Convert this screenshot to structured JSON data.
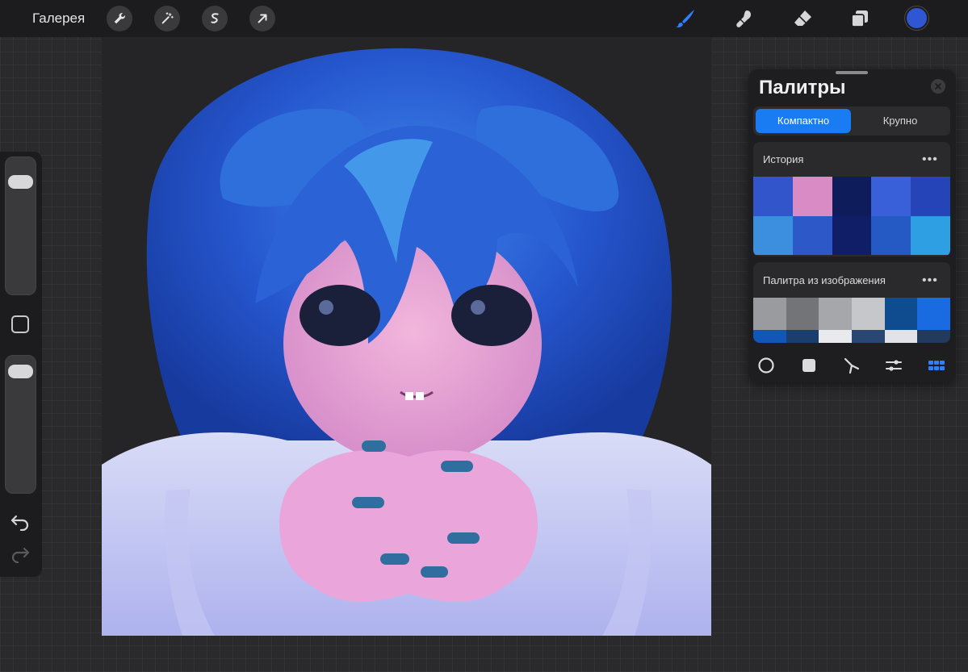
{
  "toolbar": {
    "gallery_label": "Галерея",
    "left_tools": [
      "wrench-icon",
      "magic-wand-icon",
      "selection-icon",
      "transform-arrow-icon"
    ],
    "right_tools": [
      "brush-icon",
      "smudge-icon",
      "eraser-icon",
      "layers-icon"
    ],
    "current_color": "#2f57d4",
    "accent_color": "#2f80ff"
  },
  "sidebar": {
    "brush_size_level": 0.12,
    "opacity_level": 0.05,
    "icons": [
      "modify-square-icon",
      "undo-icon",
      "redo-icon"
    ]
  },
  "palettes_panel": {
    "title": "Палитры",
    "view_modes": [
      {
        "label": "Компактно",
        "active": true
      },
      {
        "label": "Крупно",
        "active": false
      }
    ],
    "palettes": [
      {
        "name": "История",
        "more": "•••",
        "swatches": [
          "#3355cc",
          "#d88bc4",
          "#0f1c5c",
          "#3960d8",
          "#2444b8",
          "#3c8fde",
          "#2d59c8",
          "#0f1e66",
          "#255ac4",
          "#2e9fe2"
        ]
      },
      {
        "name": "Палитра из изображения",
        "more": "•••",
        "swatches": [
          "#9a9b9e",
          "#737477",
          "#a6a7aa",
          "#c6c7ca",
          "#0f4b8f",
          "#1a6ae2",
          "#1257b8",
          "#1a3e6e",
          "#e8eaee",
          "#2a4672",
          "#e1e3e8",
          "#213a5e"
        ]
      }
    ],
    "bottom_tools": [
      "disc-icon",
      "classic-square-icon",
      "harmony-icon",
      "value-sliders-icon",
      "palettes-grid-icon"
    ],
    "active_bottom_tool_color": "#2f80ff"
  }
}
